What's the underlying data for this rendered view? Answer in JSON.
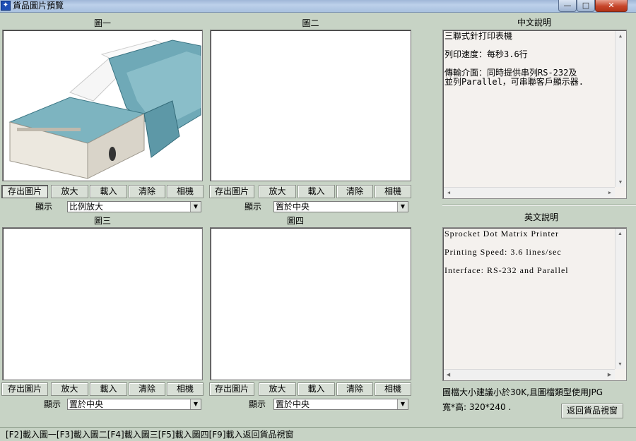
{
  "window": {
    "title": "貨品圖片預覽",
    "min_glyph": "—",
    "max_glyph": "□",
    "close_glyph": "✕"
  },
  "panels": [
    {
      "label": "圖一",
      "display_label": "顯示",
      "display_value": "比例放大"
    },
    {
      "label": "圖二",
      "display_label": "顯示",
      "display_value": "置於中央"
    },
    {
      "label": "圖三",
      "display_label": "顯示",
      "display_value": "置於中央"
    },
    {
      "label": "圖四",
      "display_label": "顯示",
      "display_value": "置於中央"
    }
  ],
  "buttons": {
    "save": "存出圖片",
    "zoom": "放大",
    "load": "載入",
    "clear": "清除",
    "camera": "相機",
    "back": "返回貨品視窗"
  },
  "chinese_desc": {
    "label": "中文說明",
    "lines": [
      "三聯式針打印表機",
      "列印速度：每秒3.6行",
      "傳輸介面：同時提供串列RS-232及\n並列Parallel，可串聯客戶顯示器."
    ]
  },
  "english_desc": {
    "label": "英文說明",
    "lines": [
      "Sprocket Dot Matrix Printer",
      "Printing Speed: 3.6 lines/sec",
      "Interface: RS-232 and Parallel"
    ]
  },
  "hint": {
    "size_note": "圖檔大小建議小於30K,且圖檔類型使用JPG",
    "dims_note": "寬*高: 320*240 ."
  },
  "statusbar": "[F2]載入圖一[F3]載入圖二[F4]載入圖三[F5]載入圖四[F9]載入返回貨品視窗"
}
